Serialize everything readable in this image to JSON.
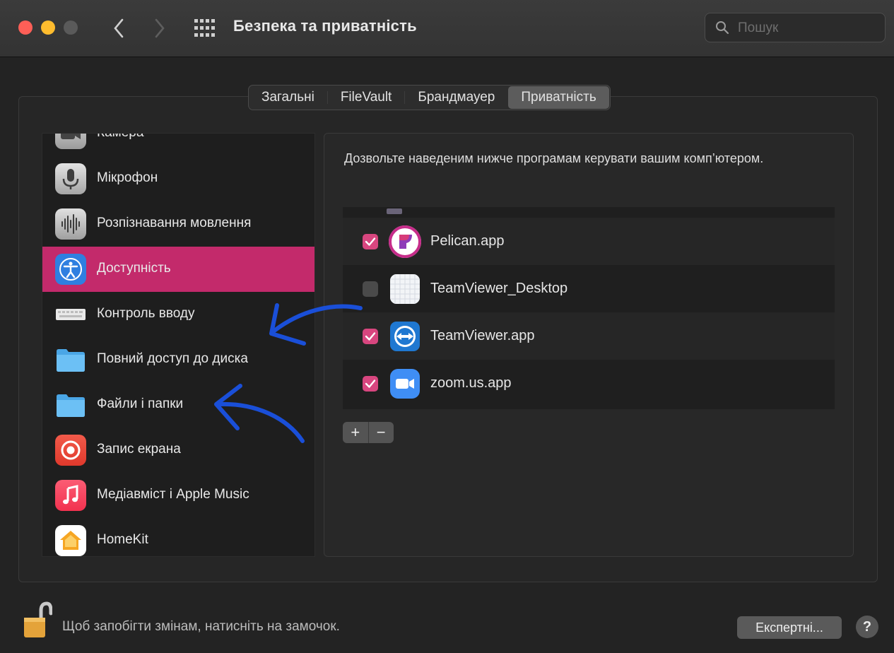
{
  "window": {
    "title": "Безпека та приватність",
    "search_placeholder": "Пошук"
  },
  "tabs": [
    {
      "label": "Загальні",
      "selected": false
    },
    {
      "label": "FileVault",
      "selected": false
    },
    {
      "label": "Брандмауер",
      "selected": false
    },
    {
      "label": "Приватність",
      "selected": true
    }
  ],
  "sidebar": {
    "items": [
      {
        "label": "Камера",
        "icon": "camera-icon",
        "selected": false
      },
      {
        "label": "Мікрофон",
        "icon": "microphone-icon",
        "selected": false
      },
      {
        "label": "Розпізнавання мовлення",
        "icon": "speech-waveform-icon",
        "selected": false
      },
      {
        "label": "Доступність",
        "icon": "accessibility-icon",
        "selected": true
      },
      {
        "label": "Контроль вводу",
        "icon": "keyboard-icon",
        "selected": false
      },
      {
        "label": "Повний доступ до диска",
        "icon": "folder-icon",
        "selected": false
      },
      {
        "label": "Файли і папки",
        "icon": "folder-icon",
        "selected": false
      },
      {
        "label": "Запис екрана",
        "icon": "screen-record-icon",
        "selected": false
      },
      {
        "label": "Медіавміст і Apple Music",
        "icon": "music-note-icon",
        "selected": false
      },
      {
        "label": "HomeKit",
        "icon": "home-icon",
        "selected": false
      }
    ]
  },
  "detail": {
    "description": "Дозвольте наведеним нижче програмам керувати вашим комп’ютером.",
    "apps": [
      {
        "name": "Pelican.app",
        "checked": true,
        "icon": "pelican-app-icon"
      },
      {
        "name": "TeamViewer_Desktop",
        "checked": false,
        "icon": "blank-app-icon"
      },
      {
        "name": "TeamViewer.app",
        "checked": true,
        "icon": "teamviewer-icon"
      },
      {
        "name": "zoom.us.app",
        "checked": true,
        "icon": "zoom-icon"
      }
    ],
    "add_label": "+",
    "remove_label": "−"
  },
  "footer": {
    "lock_text": "Щоб запобігти змінам, натисніть на замочок.",
    "advanced_label": "Експертні...",
    "help_label": "?"
  },
  "colors": {
    "selection": "#c32a6b",
    "checkbox_on": "#d8467f",
    "annotation_arrow": "#1a4fd8"
  }
}
